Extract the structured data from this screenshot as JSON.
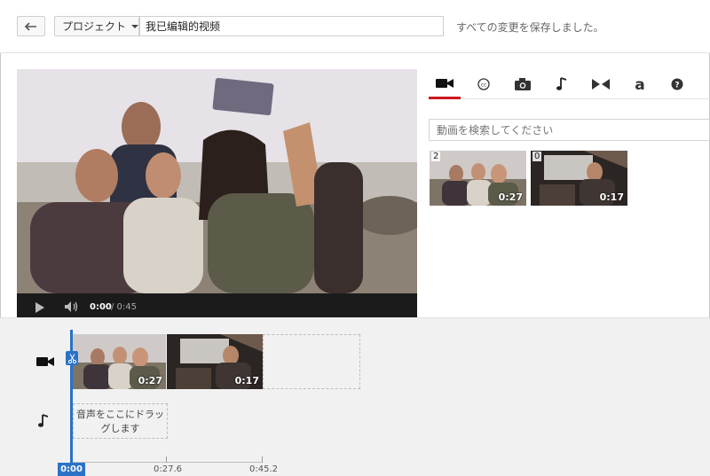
{
  "header": {
    "project_label": "プロジェクト",
    "title_value": "我已编辑的视频",
    "save_status": "すべての変更を保存しました。"
  },
  "player": {
    "current_time": "0:00",
    "total_time": "/ 0:45",
    "progress_fraction": 0.0
  },
  "panel": {
    "tabs": [
      "video-camera-icon",
      "captions-icon",
      "photo-camera-icon",
      "music-note-icon",
      "transitions-icon",
      "text-icon",
      "help-icon"
    ],
    "active_tab": 0,
    "search_placeholder": "動画を検索してください",
    "results": [
      {
        "count": "2",
        "duration": "0:27"
      },
      {
        "count": "0",
        "duration": "0:17"
      }
    ]
  },
  "timeline": {
    "clips": [
      {
        "duration": "0:27"
      },
      {
        "duration": "0:17"
      }
    ],
    "audio_drop_text": "音声をここにドラッグします",
    "ruler": [
      "0:00",
      "0:27.6",
      "0:45.2"
    ],
    "playhead_time": "0:00"
  },
  "colors": {
    "accent_red": "#cc181e",
    "playhead_blue": "#2a72c8",
    "timeline_bg": "#f1f1f1"
  }
}
